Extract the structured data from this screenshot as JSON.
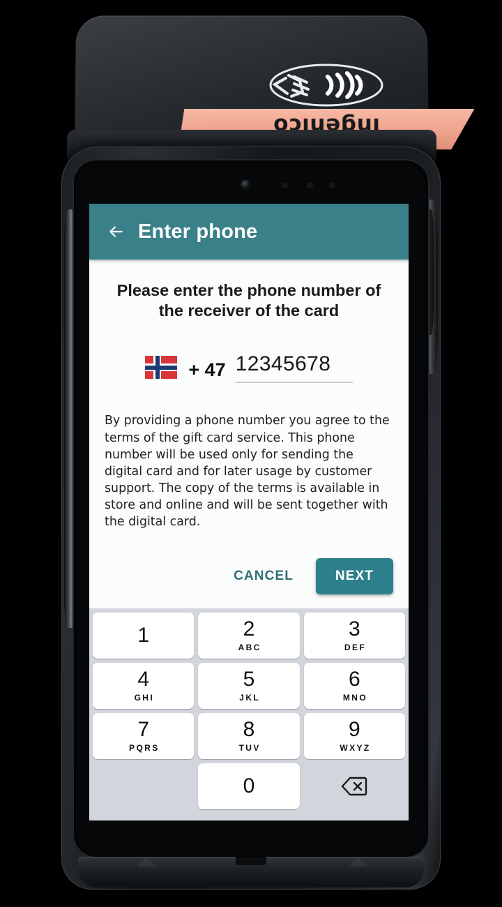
{
  "device": {
    "brand": "ingenico",
    "nfc_icon": "contactless-payment-icon"
  },
  "appbar": {
    "back_icon": "back-arrow-icon",
    "title": "Enter phone"
  },
  "screen": {
    "prompt": "Please enter the phone number of the receiver of the card",
    "phone": {
      "flag_icon": "norway-flag-icon",
      "country_code": "+ 47",
      "value": "12345678",
      "placeholder": ""
    },
    "terms": "By providing a phone number you agree to the terms of the gift card service. This phone number will be used only for sending the digital card and for later usage by customer support. The copy of the terms is available in store and online and will be sent together with the digital card.",
    "actions": {
      "cancel_label": "CANCEL",
      "next_label": "NEXT"
    }
  },
  "keypad": {
    "rows": [
      [
        {
          "digit": "1",
          "letters": ""
        },
        {
          "digit": "2",
          "letters": "ABC"
        },
        {
          "digit": "3",
          "letters": "DEF"
        }
      ],
      [
        {
          "digit": "4",
          "letters": "GHI"
        },
        {
          "digit": "5",
          "letters": "JKL"
        },
        {
          "digit": "6",
          "letters": "MNO"
        }
      ],
      [
        {
          "digit": "7",
          "letters": "PQRS"
        },
        {
          "digit": "8",
          "letters": "TUV"
        },
        {
          "digit": "9",
          "letters": "WXYZ"
        }
      ],
      [
        {
          "digit": "",
          "letters": ""
        },
        {
          "digit": "0",
          "letters": ""
        },
        {
          "digit": "backspace-icon",
          "letters": ""
        }
      ]
    ]
  },
  "colors": {
    "appbar_teal": "#3a8089",
    "next_teal": "#2e7f8c",
    "cancel_teal": "#2e6f78",
    "keypad_bg": "#d2d5db",
    "key_white": "#ffffff",
    "screen_bg": "#fbfcfc",
    "flag_red": "#d8353a",
    "flag_blue": "#1b3a73",
    "printer_salmon": "#f0a78f"
  }
}
